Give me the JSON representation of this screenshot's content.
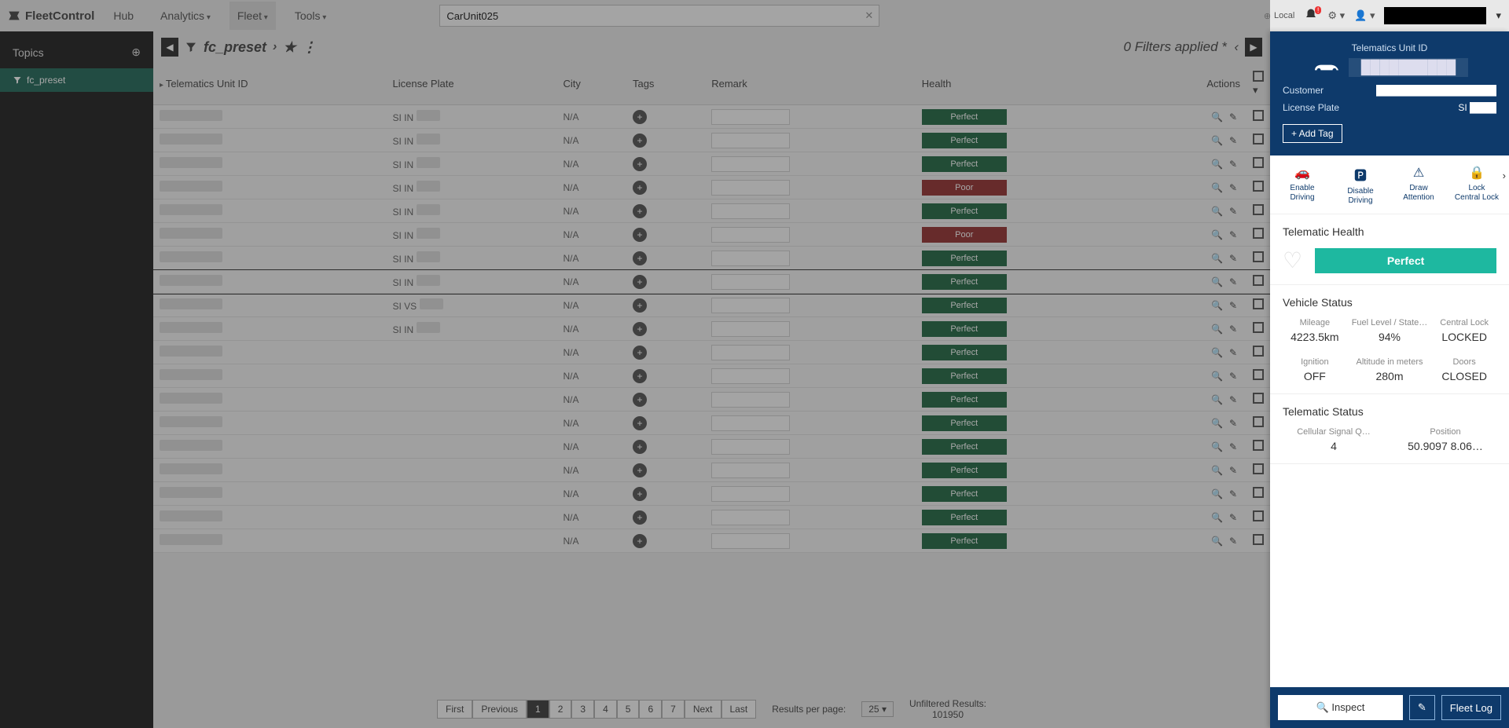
{
  "app": {
    "name": "FleetControl"
  },
  "nav": {
    "items": [
      {
        "label": "Hub"
      },
      {
        "label": "Analytics",
        "dropdown": true
      },
      {
        "label": "Fleet",
        "dropdown": true,
        "active": true
      },
      {
        "label": "Tools",
        "dropdown": true
      }
    ],
    "search_value": "CarUnit025",
    "env": "Local"
  },
  "sidebar": {
    "header": "Topics",
    "items": [
      {
        "label": "fc_preset",
        "active": true
      }
    ]
  },
  "main": {
    "preset": "fc_preset",
    "filters_status": "0 Filters applied *",
    "columns": [
      "Telematics Unit ID",
      "License Plate",
      "City",
      "Tags",
      "Remark",
      "Health",
      "Actions"
    ],
    "rows": [
      {
        "plate": "SI IN",
        "city": "N/A",
        "health": "Perfect"
      },
      {
        "plate": "SI IN",
        "city": "N/A",
        "health": "Perfect"
      },
      {
        "plate": "SI IN",
        "city": "N/A",
        "health": "Perfect"
      },
      {
        "plate": "SI IN",
        "city": "N/A",
        "health": "Poor"
      },
      {
        "plate": "SI IN",
        "city": "N/A",
        "health": "Perfect"
      },
      {
        "plate": "SI IN",
        "city": "N/A",
        "health": "Poor"
      },
      {
        "plate": "SI IN",
        "city": "N/A",
        "health": "Perfect"
      },
      {
        "plate": "SI IN",
        "city": "N/A",
        "health": "Perfect",
        "selected": true
      },
      {
        "plate": "SI VS",
        "city": "N/A",
        "health": "Perfect"
      },
      {
        "plate": "SI IN",
        "city": "N/A",
        "health": "Perfect"
      },
      {
        "plate": "",
        "city": "N/A",
        "health": "Perfect"
      },
      {
        "plate": "",
        "city": "N/A",
        "health": "Perfect"
      },
      {
        "plate": "",
        "city": "N/A",
        "health": "Perfect"
      },
      {
        "plate": "",
        "city": "N/A",
        "health": "Perfect"
      },
      {
        "plate": "",
        "city": "N/A",
        "health": "Perfect"
      },
      {
        "plate": "",
        "city": "N/A",
        "health": "Perfect"
      },
      {
        "plate": "",
        "city": "N/A",
        "health": "Perfect"
      },
      {
        "plate": "",
        "city": "N/A",
        "health": "Perfect"
      },
      {
        "plate": "",
        "city": "N/A",
        "health": "Perfect"
      }
    ],
    "pagination": {
      "first": "First",
      "prev": "Previous",
      "next": "Next",
      "last": "Last",
      "pages": [
        "1",
        "2",
        "3",
        "4",
        "5",
        "6",
        "7"
      ],
      "current": "1",
      "per_page_label": "Results per page:",
      "per_page": "25",
      "unfiltered_label": "Unfiltered Results:",
      "unfiltered": "101950"
    }
  },
  "detail": {
    "title": "Telematics Unit ID",
    "unit_id": "██████████",
    "customer_label": "Customer",
    "customer": "██████████████████",
    "plate_label": "License Plate",
    "plate": "SI ████",
    "add_tag": "+ Add Tag",
    "actions": [
      {
        "icon": "🚗",
        "l1": "Enable",
        "l2": "Driving"
      },
      {
        "icon": "🅿",
        "l1": "Disable",
        "l2": "Driving"
      },
      {
        "icon": "⚠",
        "l1": "Draw",
        "l2": "Attention"
      },
      {
        "icon": "🔒",
        "l1": "Lock",
        "l2": "Central Lock"
      }
    ],
    "health_title": "Telematic Health",
    "health_value": "Perfect",
    "vehicle_title": "Vehicle Status",
    "vehicle": [
      {
        "lab": "Mileage",
        "val": "4223.5km"
      },
      {
        "lab": "Fuel Level / State…",
        "val": "94%"
      },
      {
        "lab": "Central Lock",
        "val": "LOCKED"
      },
      {
        "lab": "Ignition",
        "val": "OFF"
      },
      {
        "lab": "Altitude in meters",
        "val": "280m"
      },
      {
        "lab": "Doors",
        "val": "CLOSED"
      }
    ],
    "telstatus_title": "Telematic Status",
    "telstatus": [
      {
        "lab": "Cellular Signal Q…",
        "val": "4"
      },
      {
        "lab": "Position",
        "val": "50.9097 8.06…"
      }
    ],
    "footer": {
      "inspect": "Inspect",
      "fleetlog": "Fleet Log"
    }
  }
}
